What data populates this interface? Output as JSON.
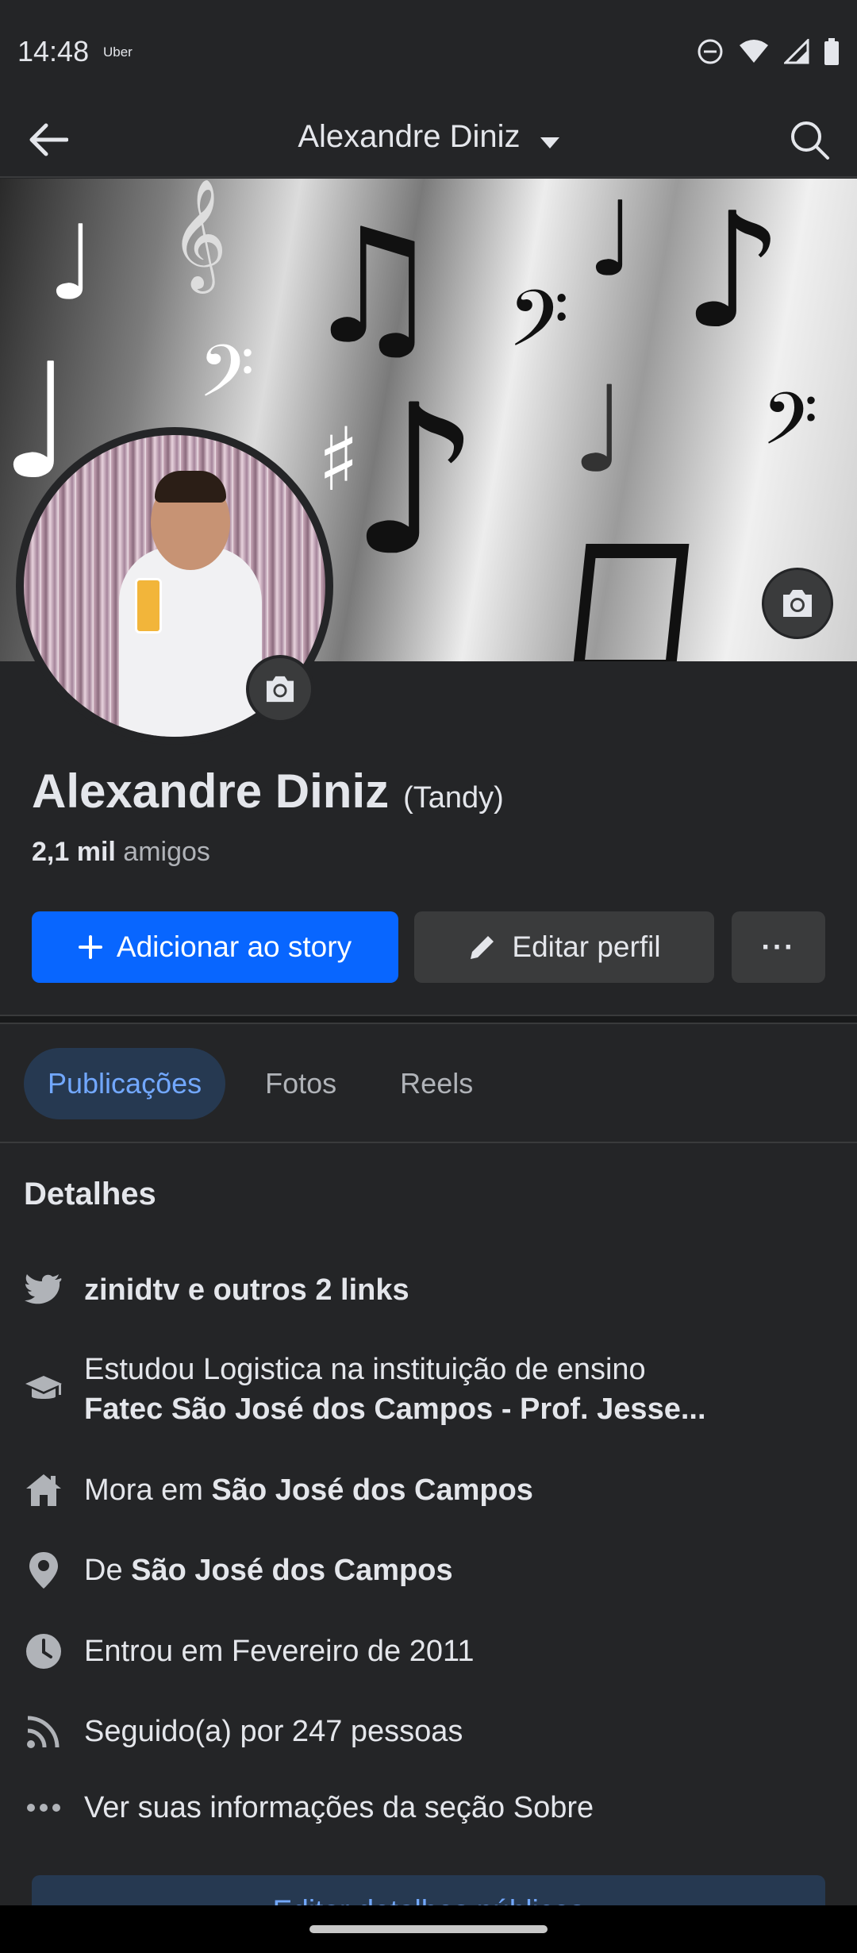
{
  "status_bar": {
    "time": "14:48",
    "app_label": "Uber",
    "icons": [
      "dnd-icon",
      "wifi-icon",
      "signal-icon",
      "battery-icon"
    ]
  },
  "topnav": {
    "title": "Alexandre Diniz",
    "back_icon": "arrow-left-icon",
    "search_icon": "search-icon"
  },
  "profile": {
    "name": "Alexandre Diniz",
    "nickname": "(Tandy)",
    "friends_count": "2,1 mil",
    "friends_label": "amigos"
  },
  "actions": {
    "add_story_label": "Adicionar ao story",
    "edit_profile_label": "Editar perfil",
    "more_label": "···"
  },
  "tabs": [
    {
      "label": "Publicações",
      "active": true
    },
    {
      "label": "Fotos",
      "active": false
    },
    {
      "label": "Reels",
      "active": false
    }
  ],
  "details": {
    "title": "Detalhes",
    "links": "zinidtv e outros 2 links",
    "education_prefix": "Estudou Logistica na instituição de ensino",
    "education_school": "Fatec São José dos Campos - Prof. Jesse...",
    "lives_prefix": "Mora em",
    "lives_city": "São José dos Campos",
    "from_prefix": "De",
    "from_city": "São José dos Campos",
    "joined": "Entrou em Fevereiro de 2011",
    "followers": "Seguido(a) por 247 pessoas",
    "see_about": "Ver suas informações da seção Sobre",
    "edit_button": "Editar detalhes públicos"
  },
  "colors": {
    "background": "#242527",
    "primary_button": "#0866ff",
    "active_tab_bg": "#263951",
    "active_tab_text": "#72a8ff",
    "secondary_button": "#3a3b3c"
  }
}
